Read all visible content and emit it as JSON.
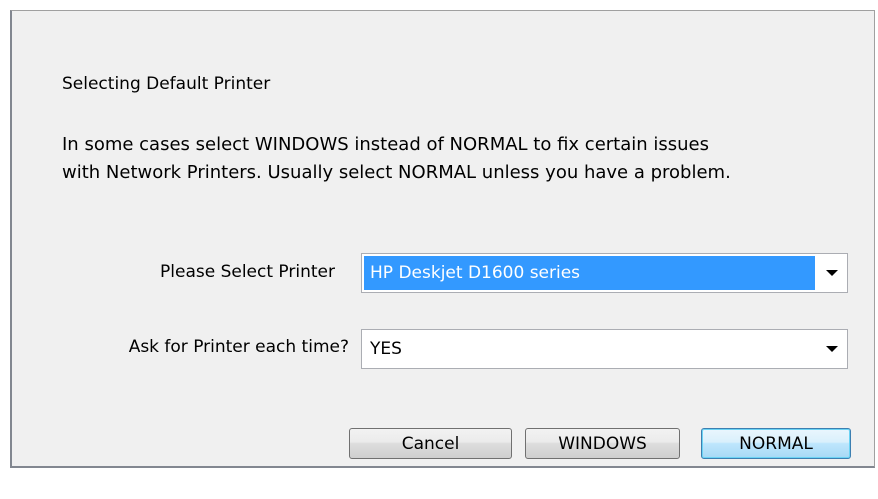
{
  "dialog": {
    "heading": "Selecting Default Printer",
    "description_line1": "In some cases select WINDOWS instead of NORMAL to fix certain issues",
    "description_line2": "with Network Printers. Usually select NORMAL unless you have a problem."
  },
  "printer_row": {
    "label": "Please Select Printer",
    "selected_value": "HP Deskjet D1600 series"
  },
  "ask_row": {
    "label": "Ask for Printer each time?",
    "selected_value": "YES"
  },
  "buttons": {
    "cancel_label": "Cancel",
    "windows_label": "WINDOWS",
    "normal_label": "NORMAL"
  },
  "icons": {
    "dropdown_arrow": "chevron-down-icon"
  },
  "colors": {
    "dialog_background": "#f0f0f0",
    "selection_highlight": "#3399ff",
    "default_button_border": "#3c7fb1"
  }
}
